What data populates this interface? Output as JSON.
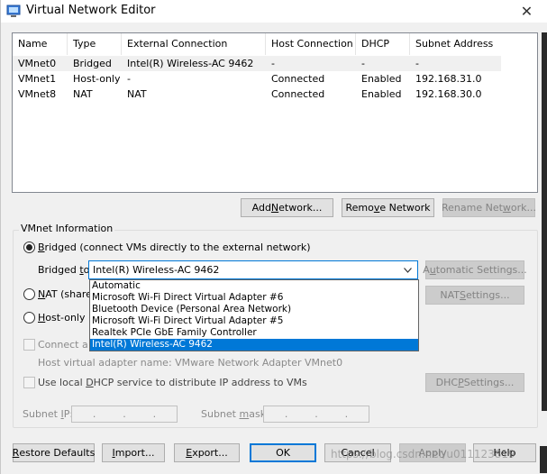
{
  "window": {
    "title": "Virtual Network Editor",
    "close_glyph": "✕",
    "title_icon": "vmware-network-icon"
  },
  "table": {
    "headers": [
      "Name",
      "Type",
      "External Connection",
      "Host Connection",
      "DHCP",
      "Subnet Address"
    ],
    "rows": [
      [
        "VMnet0",
        "Bridged",
        "Intel(R) Wireless-AC 9462",
        "-",
        "-",
        "-"
      ],
      [
        "VMnet1",
        "Host-only",
        "-",
        "Connected",
        "Enabled",
        "192.168.31.0"
      ],
      [
        "VMnet8",
        "NAT",
        "NAT",
        "Connected",
        "Enabled",
        "192.168.30.0"
      ]
    ]
  },
  "net_buttons": {
    "add_pre": "Add ",
    "add_u": "N",
    "add_post": "etwork...",
    "remove_pre": "Remo",
    "remove_u": "v",
    "remove_post": "e Network",
    "rename_pre": "Rename Net",
    "rename_u": "w",
    "rename_post": "ork..."
  },
  "vmnet_info": {
    "group_label": "VMnet Information",
    "bridged_pre": "",
    "bridged_u": "B",
    "bridged_post": "ridged (connect VMs directly to the external network)",
    "bridged_to_pre": "Bridged ",
    "bridged_to_u": "t",
    "bridged_to_post": "o:",
    "bridged_to_value": "Intel(R) Wireless-AC 9462",
    "auto_pre": "A",
    "auto_u": "u",
    "auto_post": "tomatic Settings...",
    "nat_pre": "",
    "nat_u": "N",
    "nat_post": "AT (shared",
    "nat_settings_pre": "NAT ",
    "nat_settings_u": "S",
    "nat_settings_post": "ettings...",
    "hostonly_pre": "",
    "hostonly_u": "H",
    "hostonly_post": "ost-only (c",
    "connect_host": "Connect a h",
    "host_adapter": "Host virtual adapter name: VMware Network Adapter VMnet0",
    "dhcp_pre": "Use local ",
    "dhcp_u": "D",
    "dhcp_post": "HCP service to distribute IP address to VMs",
    "dhcp_settings_pre": "DHC",
    "dhcp_settings_u": "P",
    "dhcp_settings_post": " Settings...",
    "subnet_ip_pre": "Subnet ",
    "subnet_ip_u": "I",
    "subnet_ip_post": "P:",
    "subnet_mask_pre": "Subnet ",
    "subnet_mask_u": "m",
    "subnet_mask_post": "ask:",
    "ip_dot": "."
  },
  "dropdown": {
    "options": [
      "Automatic",
      "Microsoft Wi-Fi Direct Virtual Adapter #6",
      "Bluetooth Device (Personal Area Network)",
      "Microsoft Wi-Fi Direct Virtual Adapter #5",
      "Realtek PCIe GbE Family Controller",
      "Intel(R) Wireless-AC 9462"
    ],
    "selected_index": 5
  },
  "bottom_buttons": {
    "restore_pre": "",
    "restore_u": "R",
    "restore_post": "estore Defaults",
    "import_pre": "",
    "import_u": "I",
    "import_post": "mport...",
    "export_pre": "",
    "export_u": "E",
    "export_post": "xport...",
    "ok": "OK",
    "cancel": "Cancel",
    "apply": "Apply",
    "help": "Help"
  },
  "watermark": "https://blog.csdn.net/u011123819"
}
